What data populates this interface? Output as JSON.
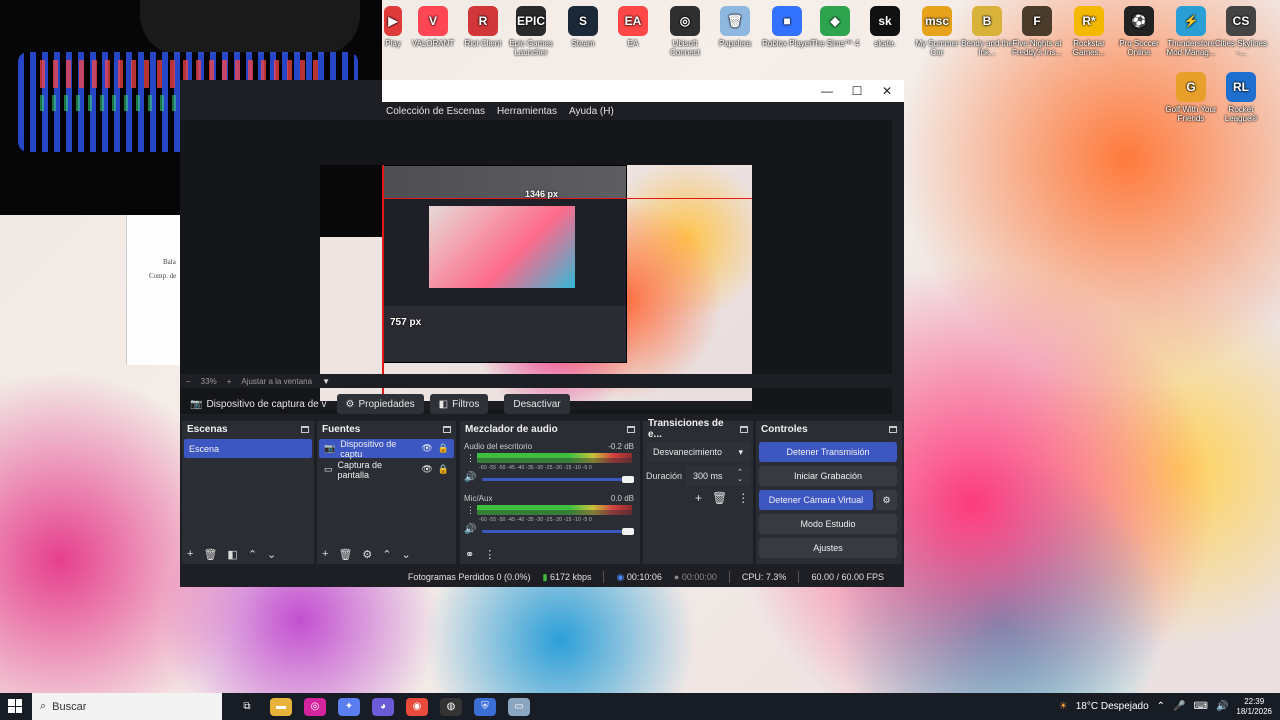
{
  "desktop": {
    "icons": [
      {
        "label": "Play",
        "color": "#e03b3b",
        "glyph": "▶"
      },
      {
        "label": "VALORANT",
        "color": "#ff4655",
        "glyph": "V"
      },
      {
        "label": "Riot Client",
        "color": "#d13639",
        "glyph": "R"
      },
      {
        "label": "Epic Games Launcher",
        "color": "#2a2a2a",
        "glyph": "EPIC"
      },
      {
        "label": "Steam",
        "color": "#1b2838",
        "glyph": "S"
      },
      {
        "label": "EA",
        "color": "#ff4747",
        "glyph": "EA"
      },
      {
        "label": "Ubisoft Connect",
        "color": "#2f2f2f",
        "glyph": "◎"
      },
      {
        "label": "Papelera",
        "color": "#8fb8e0",
        "glyph": "🗑"
      },
      {
        "label": "Roblox Player",
        "color": "#3372ff",
        "glyph": "■"
      },
      {
        "label": "The Sims™ 4",
        "color": "#2ea44f",
        "glyph": "◆"
      },
      {
        "label": "skate.",
        "color": "#111111",
        "glyph": "sk"
      },
      {
        "label": "My Summer Car",
        "color": "#e6a31b",
        "glyph": "msc"
      },
      {
        "label": "Bendy and the Ink...",
        "color": "#d9b23a",
        "glyph": "B"
      },
      {
        "label": "Five Nights at Freddy's Ins...",
        "color": "#4a3b2a",
        "glyph": "F"
      },
      {
        "label": "Rockstar Games...",
        "color": "#f5b800",
        "glyph": "R*"
      },
      {
        "label": "Pro Soccer Online",
        "color": "#222222",
        "glyph": "⚽"
      },
      {
        "label": "Thunderstore Mod Manag...",
        "color": "#2a9fd6",
        "glyph": "⚡"
      },
      {
        "label": "Cities Skylines -...",
        "color": "#444444",
        "glyph": "CS"
      },
      {
        "label": "Golf With Your Friends",
        "color": "#e8a02b",
        "glyph": "G"
      },
      {
        "label": "Rocket League®",
        "color": "#1f6fd1",
        "glyph": "RL"
      }
    ]
  },
  "bg_doc": {
    "line1": "Bala",
    "line2": "Comp. de"
  },
  "obs": {
    "menu": [
      "Colección de Escenas",
      "Herramientas",
      "Ayuda (H)"
    ],
    "window_controls": {
      "minimize": "—",
      "maximize": "☐",
      "close": "✕"
    },
    "preview": {
      "width_label": "1346 px",
      "height_label": "757 px"
    },
    "zoom": {
      "minus": "−",
      "value": "33%",
      "plus": "+",
      "fit": "Ajustar a la ventana",
      "dropdown": "▼"
    },
    "source_toolbar": {
      "source_name": "Dispositivo de captura de v",
      "properties": "Propiedades",
      "filters": "Filtros",
      "deactivate": "Desactivar"
    },
    "scenes": {
      "title": "Escenas",
      "items": [
        "Escena"
      ]
    },
    "sources": {
      "title": "Fuentes",
      "items": [
        {
          "label": "Dispositivo de captu",
          "icon": "camera-icon"
        },
        {
          "label": "Captura de pantalla",
          "icon": "monitor-icon"
        }
      ]
    },
    "mixer": {
      "title": "Mezclador de audio",
      "channels": [
        {
          "name": "Audio del escritorio",
          "db": "-0.2 dB",
          "scale": "-60 -55 -50 -45 -40 -35 -30 -25 -20 -15 -10 -5 0"
        },
        {
          "name": "Mic/Aux",
          "db": "0.0 dB",
          "scale": "-60 -55 -50 -45 -40 -35 -30 -25 -20 -15 -10 -5 0"
        }
      ]
    },
    "transitions": {
      "title": "Transiciones de e...",
      "type": "Desvanecimiento",
      "duration_label": "Duración",
      "duration_value": "300 ms"
    },
    "controls": {
      "title": "Controles",
      "stop_stream": "Detener Transmisión",
      "start_recording": "Iniciar Grabación",
      "stop_virtual_cam": "Detener Cámara Virtual",
      "studio_mode": "Modo Estudio",
      "settings": "Ajustes"
    },
    "status": {
      "dropped_frames": "Fotogramas Perdidos 0 (0.0%)",
      "bitrate": "6172 kbps",
      "stream_time": "00:10:06",
      "rec_time": "00:00:00",
      "cpu": "CPU: 7.3%",
      "fps": "60.00 / 60.00 FPS"
    }
  },
  "taskbar": {
    "search_placeholder": "Buscar",
    "weather": "18°C Despejado",
    "time": "22:39",
    "date": "18/1/2026"
  }
}
